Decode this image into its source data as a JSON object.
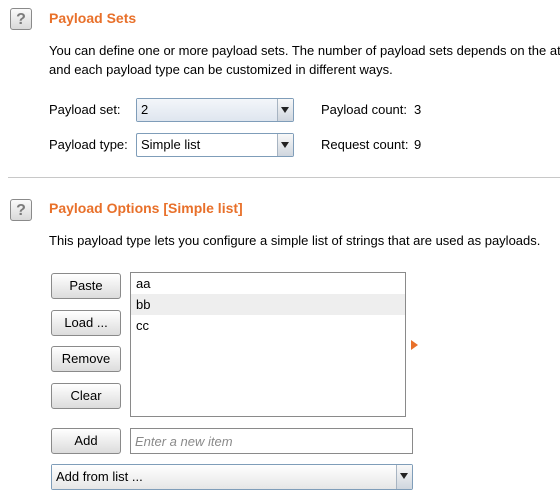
{
  "payload_sets": {
    "title": "Payload Sets",
    "description_line1": "You can define one or more payload sets. The number of payload sets depends on the at",
    "description_line2": "and each payload type can be customized in different ways.",
    "set_label": "Payload set:",
    "set_value": "2",
    "type_label": "Payload type:",
    "type_value": "Simple list",
    "count_label": "Payload count:",
    "count_value": "3",
    "request_label": "Request count:",
    "request_value": "9"
  },
  "payload_options": {
    "title": "Payload Options [Simple list]",
    "description": "This payload type lets you configure a simple list of strings that are used as payloads.",
    "buttons": {
      "paste": "Paste",
      "load": "Load ...",
      "remove": "Remove",
      "clear": "Clear",
      "add": "Add"
    },
    "items": [
      "aa",
      "bb",
      "cc"
    ],
    "new_item_placeholder": "Enter a new item",
    "add_from_list": "Add from list ..."
  },
  "icons": {
    "help": "?",
    "accent_color": "#e8702a"
  }
}
